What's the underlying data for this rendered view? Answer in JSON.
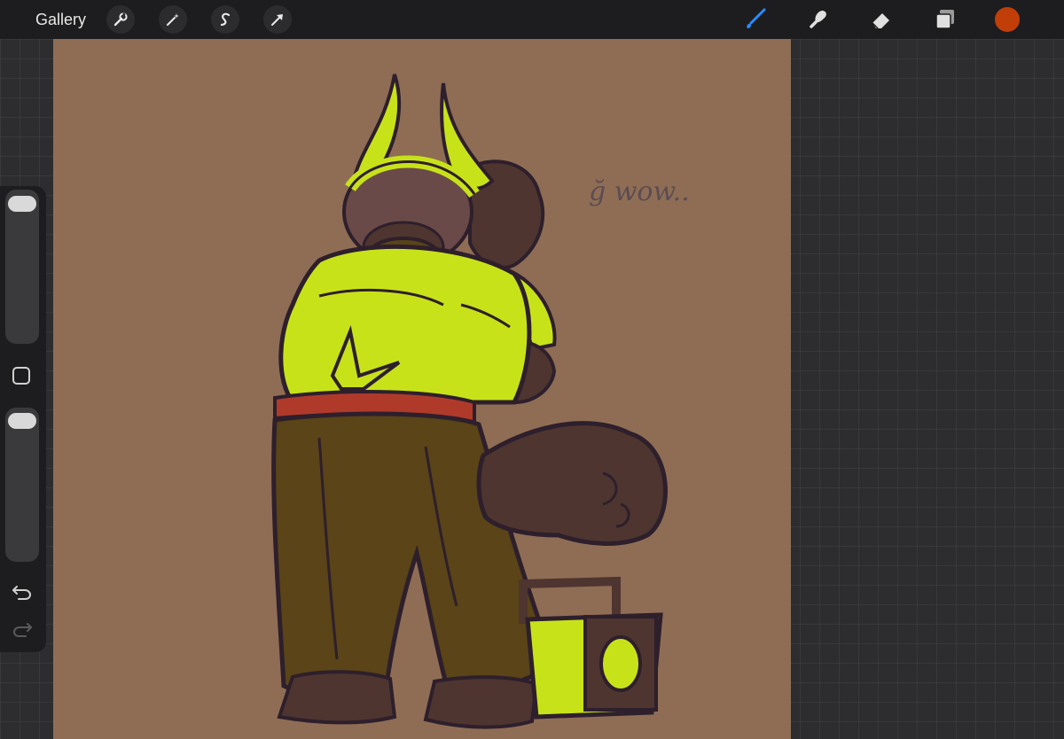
{
  "topbar": {
    "gallery_label": "Gallery",
    "actions": [
      {
        "name": "actions",
        "icon": "wrench-icon"
      },
      {
        "name": "adjustments",
        "icon": "magic-wand-icon"
      },
      {
        "name": "selection",
        "icon": "selection-s-icon"
      },
      {
        "name": "transform",
        "icon": "arrow-cursor-icon"
      }
    ],
    "tools": [
      {
        "name": "brush",
        "icon": "brush-icon",
        "active": true
      },
      {
        "name": "smudge",
        "icon": "smudge-icon",
        "active": false
      },
      {
        "name": "eraser",
        "icon": "eraser-icon",
        "active": false
      },
      {
        "name": "layers",
        "icon": "layers-icon",
        "active": false
      }
    ],
    "current_color": "#c23e08"
  },
  "sidebar": {
    "brush_size_level": 0.0,
    "opacity_level": 0.0,
    "modify_button_icon": "square-icon",
    "undo_icon": "undo-icon",
    "redo_icon": "redo-icon"
  },
  "canvas": {
    "background_color": "#8f6d55",
    "sketch_note": "ğ wow..",
    "colors": {
      "shirt": "#c8e21a",
      "pants": "#5a4418",
      "belt": "#b03a2a",
      "skin": "#6a4a48",
      "outline": "#2e1f2c",
      "fur": "#4e3530"
    }
  }
}
